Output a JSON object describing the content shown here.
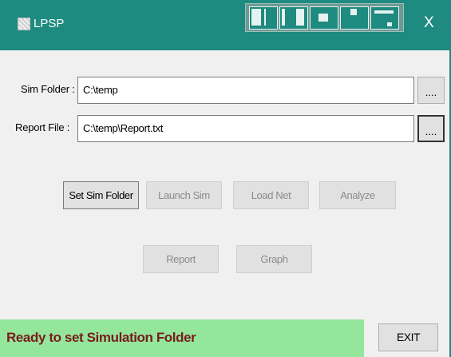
{
  "window": {
    "title": "LPSP",
    "close_glyph": "X"
  },
  "sim_folder": {
    "label": "Sim Folder :",
    "value": "C:\\temp",
    "browse_label": "...."
  },
  "report_file": {
    "label": "Report File :",
    "value": "C:\\temp\\Report.txt",
    "browse_label": "...."
  },
  "buttons": {
    "set_sim_folder": "Set Sim Folder",
    "launch_sim": "Launch Sim",
    "load_net": "Load Net",
    "analyze": "Analyze",
    "report": "Report",
    "graph": "Graph",
    "exit": "EXIT"
  },
  "status": {
    "text": "Ready to set Simulation Folder"
  },
  "colors": {
    "titlebar": "#1f8a80",
    "status_bg": "#93e69c",
    "status_text": "#7a1c1c",
    "disabled_text": "#8b8b8b"
  }
}
